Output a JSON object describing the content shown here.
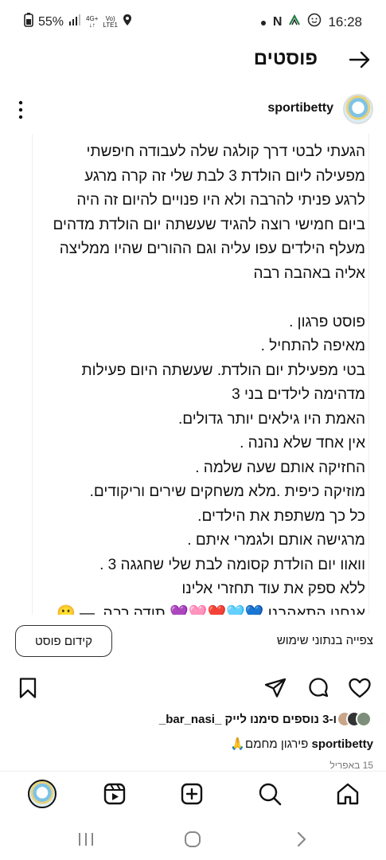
{
  "status_bar": {
    "battery": "55%",
    "network_top": "4G+",
    "network_bottom": "LTE1",
    "volte_top": "Vo)",
    "volte_bottom": "LTE1",
    "time": "16:28"
  },
  "header": {
    "title": "פוסטים"
  },
  "author": {
    "username": "sportibetty"
  },
  "post": {
    "text": "הגעתי לבטי דרך קולגה שלה לעבודה חיפשתי\nמפעילה ליום הולדת 3 לבת שלי זה קרה מרגע\nלרגע פניתי להרבה ולא היו פנויים להיום זה היה\nביום חמישי רוצה להגיד שעשתה יום הולדת מדהים\nמעלף הילדים עפו עליה וגם ההורים שהיו ממליצה\nאליה באהבה רבה\n\nפוסט פרגון .\nמאיפה להתחיל .\nבטי מפעילת יום הולדת. שעשתה היום פעילות\nמדהימה לילדים בני 3\nהאמת היו גילאים יותר גדולים.\nאין אחד שלא נהנה .\nהחזיקה אותם שעה שלמה .\nמוזיקה כיפית .מלא משחקים שירים וריקודים.\nכל כך משתפת את הילדים.\nמרגישה אותם ולגמרי איתם .\nוואוו יום הולדת קסומה לבת שלי שחגגה 3 .\nללא ספק את עוד תחזרי אלינו\nאנחנו התאהבנו 💙🩵❤️🩷💜 תודה רבה. — 🙂"
  },
  "usage": {
    "insights_label": "צפייה בנתוני שימוש",
    "promote_label": "קידום פוסט"
  },
  "likes": {
    "text": "ו-3 נוספים סימנו לייק _bar_nasi_"
  },
  "caption": {
    "username": "sportibetty",
    "text": "פירגון מחמם🙏"
  },
  "date": "15 באפריל",
  "colors": {
    "accent": "#111111",
    "text_muted": "#777777"
  }
}
